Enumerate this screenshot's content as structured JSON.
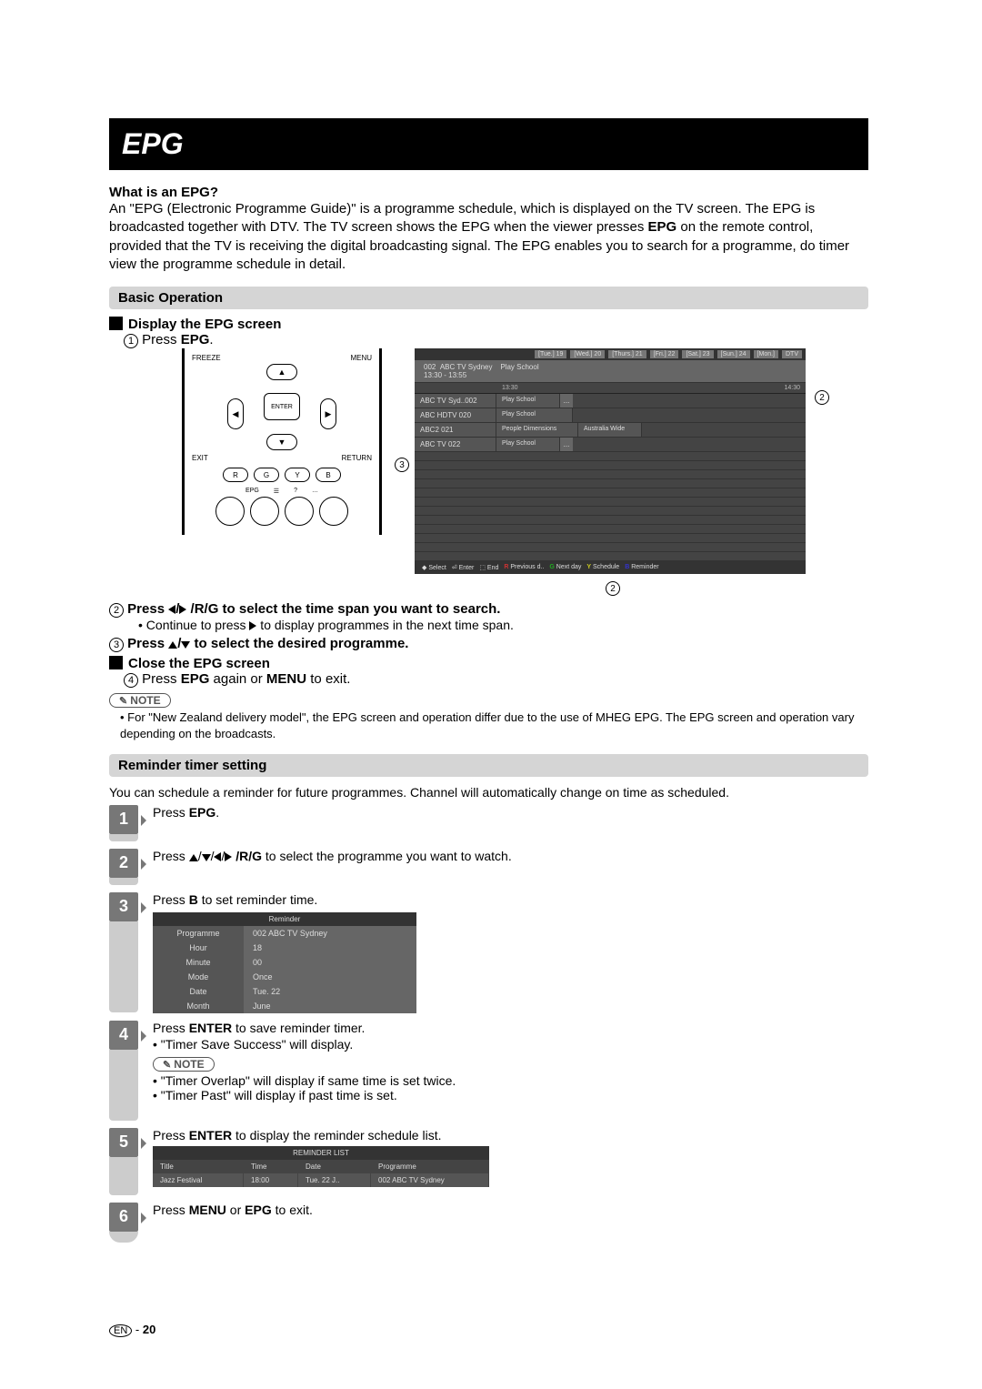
{
  "title": "EPG",
  "intro": {
    "q": "What is an EPG?",
    "body": "An \"EPG (Electronic Programme Guide)\" is a programme schedule, which is displayed on the TV screen. The EPG is broadcasted together with DTV. The TV screen shows the EPG when the viewer presses ",
    "epg": "EPG",
    "body2": " on the remote control, provided that the TV is receiving the digital broadcasting signal. The EPG enables you to search for a programme, do timer view the programme schedule in detail."
  },
  "basic": {
    "head": "Basic Operation",
    "display": "Display the EPG screen",
    "step1a": "Press ",
    "step1b": "EPG",
    "step2": "Press ",
    "step2arrows": "◀/▶",
    "step2b": " /R/G to select the time span you want to search.",
    "step2sub": "Continue to press ",
    "step2sub2": " to display programmes in the next time span.",
    "step3a": "Press ",
    "step3arrows": "▲/▼",
    "step3b": " to select the desired programme.",
    "close": "Close the EPG screen",
    "step4a": "Press ",
    "step4b": "EPG",
    "step4c": " again or ",
    "step4d": "MENU",
    "step4e": " to exit."
  },
  "note1": {
    "label": "NOTE",
    "text": "For \"New Zealand delivery model\", the EPG screen and operation differ due to the use of MHEG EPG. The EPG screen and operation vary depending on the broadcasts."
  },
  "remote": {
    "freeze": "FREEZE",
    "menu": "MENU",
    "enter": "ENTER",
    "exit": "EXIT",
    "return": "RETURN",
    "r": "R",
    "g": "G",
    "y": "Y",
    "b": "B",
    "epg": "EPG"
  },
  "epg_screen": {
    "days": [
      "[Tue.] 19",
      "[Wed.] 20",
      "[Thurs.] 21",
      "[Fri.] 22",
      "[Sat.] 23",
      "[Sun.] 24",
      "[Mon.]",
      "DTV"
    ],
    "chn": "002",
    "chname": "ABC TV Sydney",
    "prog": "Play School",
    "time": "13:30  -  13:55",
    "t1": "13:30",
    "t2": "14:30",
    "rows": [
      {
        "ch": "ABC TV Syd..002",
        "p": "Play School",
        "d": "..."
      },
      {
        "ch": "ABC HDTV    020",
        "p": "Play School",
        "d": ""
      },
      {
        "ch": "ABC2            021",
        "p": "People Dimensions",
        "d": "",
        "p2": "Australia Wide"
      },
      {
        "ch": "ABC TV         022",
        "p": "Play School",
        "d": "..."
      }
    ],
    "foot": {
      "sel": "Select",
      "ent": "Enter",
      "end": "End",
      "r": "Previous d..",
      "g": "Next day",
      "y": "Schedule",
      "b": "Reminder"
    }
  },
  "reminder": {
    "head": "Reminder timer setting",
    "intro": "You can schedule a reminder for future programmes. Channel will automatically change on time as scheduled.",
    "s1a": "Press  ",
    "s1b": "EPG",
    "s1c": ".",
    "s2a": "Press ",
    "s2ar": "▲/▼/◀/▶",
    "s2b": " /R/G",
    "s2c": " to select the programme you want to watch.",
    "s3a": "Press ",
    "s3b": "B",
    "s3c": " to set reminder time.",
    "s4a": "Press ",
    "s4b": "ENTER",
    "s4c": " to save reminder timer.",
    "s4n1": "\"Timer Save Success\" will display.",
    "s4n2": "\"Timer Overlap\" will display if same time is set twice.",
    "s4n3": "\"Timer Past\" will display if past time is set.",
    "s5a": "Press ",
    "s5b": "ENTER",
    "s5c": " to display the reminder schedule list.",
    "s6a": "Press ",
    "s6b": "MENU",
    "s6c": " or ",
    "s6d": "EPG",
    "s6e": " to exit.",
    "note": "NOTE"
  },
  "rtab": {
    "title": "Reminder",
    "rows": [
      {
        "k": "Programme",
        "v": "002 ABC TV Sydney"
      },
      {
        "k": "Hour",
        "v": "18"
      },
      {
        "k": "Minute",
        "v": "00"
      },
      {
        "k": "Mode",
        "v": "Once"
      },
      {
        "k": "Date",
        "v": "Tue. 22"
      },
      {
        "k": "Month",
        "v": "June"
      }
    ]
  },
  "rlist": {
    "title": "REMINDER LIST",
    "h": [
      "Title",
      "Time",
      "Date",
      "Programme"
    ],
    "row": [
      "Jazz Festival",
      "18:00",
      "Tue. 22 J..",
      "002 ABC TV Sydney"
    ]
  },
  "page": {
    "lang": "EN",
    "num": "20"
  }
}
